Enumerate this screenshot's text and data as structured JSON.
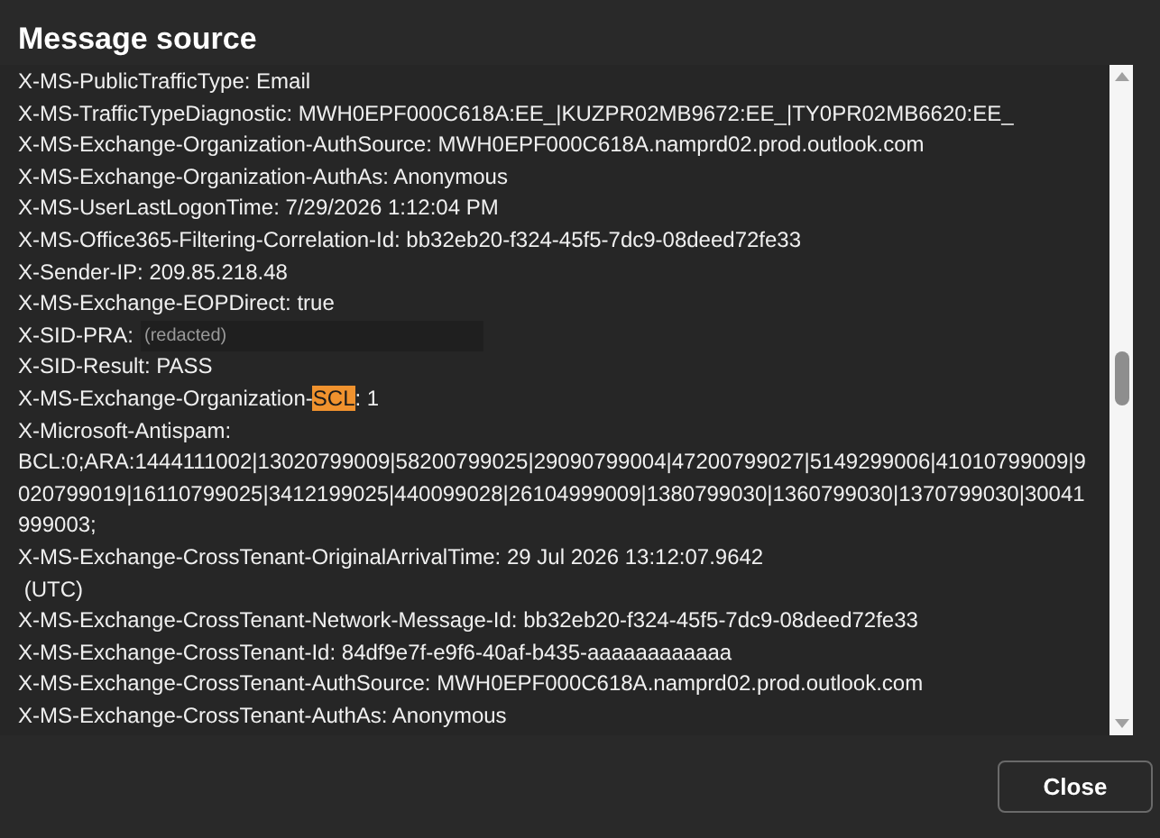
{
  "dialog": {
    "title": "Message source"
  },
  "source_lines": [
    {
      "parts": [
        {
          "text": "X-MS-PublicTrafficType: Email",
          "highlighted": false
        }
      ]
    },
    {
      "parts": [
        {
          "text": "X-MS-TrafficTypeDiagnostic: MWH0EPF000C618A:EE_|KUZPR02MB9672:EE_|TY0PR02MB6620:EE_",
          "highlighted": false
        }
      ]
    },
    {
      "parts": [
        {
          "text": "X-MS-Exchange-Organization-AuthSource: MWH0EPF000C618A.namprd02.prod.outlook.com",
          "highlighted": false
        }
      ]
    },
    {
      "parts": [
        {
          "text": "X-MS-Exchange-Organization-AuthAs: Anonymous",
          "highlighted": false
        }
      ]
    },
    {
      "parts": [
        {
          "text": "X-MS-UserLastLogonTime: 7/29/2026 1:12:04 PM",
          "highlighted": false
        }
      ]
    },
    {
      "parts": [
        {
          "text": "X-MS-Office365-Filtering-Correlation-Id: bb32eb20-f324-45f5-7dc9-08deed72fe33",
          "highlighted": false
        }
      ]
    },
    {
      "parts": [
        {
          "text": "X-Sender-IP: 209.85.218.48",
          "highlighted": false
        }
      ]
    },
    {
      "parts": [
        {
          "text": "X-MS-Exchange-EOPDirect: true",
          "highlighted": false
        }
      ]
    },
    {
      "parts": [
        {
          "text": "X-SID-PRA:",
          "highlighted": false
        }
      ],
      "redaction": "(redacted)"
    },
    {
      "parts": [
        {
          "text": "X-SID-Result: PASS",
          "highlighted": false
        }
      ]
    },
    {
      "parts": [
        {
          "text": "X-MS-Exchange-Organization-",
          "highlighted": false
        },
        {
          "text": "SCL",
          "highlighted": true
        },
        {
          "text": ": 1",
          "highlighted": false
        }
      ]
    },
    {
      "parts": [
        {
          "text": "X-Microsoft-Antispam:",
          "highlighted": false
        }
      ]
    },
    {
      "parts": [
        {
          "text": "BCL:0;ARA:1444111002|13020799009|58200799025|29090799004|47200799027|5149299006|41010799009|9",
          "highlighted": false
        }
      ]
    },
    {
      "parts": [
        {
          "text": "020799019|16110799025|3412199025|440099028|26104999009|1380799030|1360799030|1370799030|30041",
          "highlighted": false
        }
      ]
    },
    {
      "parts": [
        {
          "text": "999003;",
          "highlighted": false
        }
      ]
    },
    {
      "parts": [
        {
          "text": "X-MS-Exchange-CrossTenant-OriginalArrivalTime: 29 Jul 2026 13:12:07.9642",
          "highlighted": false
        }
      ]
    },
    {
      "parts": [
        {
          "text": " (UTC)",
          "highlighted": false
        }
      ]
    },
    {
      "parts": [
        {
          "text": "X-MS-Exchange-CrossTenant-Network-Message-Id: bb32eb20-f324-45f5-7dc9-08deed72fe33",
          "highlighted": false
        }
      ]
    },
    {
      "parts": [
        {
          "text": "X-MS-Exchange-CrossTenant-Id: 84df9e7f-e9f6-40af-b435-aaaaaaaaaaaa",
          "highlighted": false
        }
      ]
    },
    {
      "parts": [
        {
          "text": "X-MS-Exchange-CrossTenant-AuthSource: MWH0EPF000C618A.namprd02.prod.outlook.com",
          "highlighted": false
        }
      ]
    },
    {
      "parts": [
        {
          "text": "X-MS-Exchange-CrossTenant-AuthAs: Anonymous",
          "highlighted": false
        }
      ]
    }
  ],
  "buttons": [
    {
      "label": "Close"
    }
  ]
}
